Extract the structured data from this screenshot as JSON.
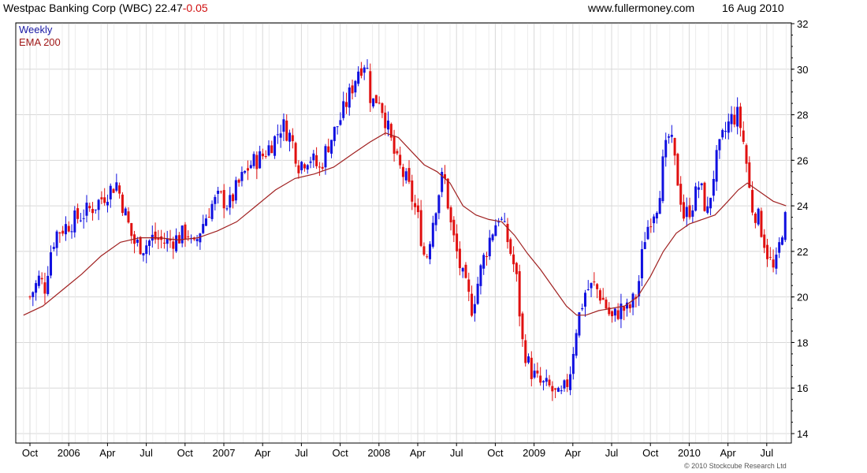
{
  "header": {
    "title": "Westpac Banking Corp (WBC)",
    "last": "22.47",
    "change": "-0.05",
    "site": "www.fullermoney.com",
    "date": "16 Aug 2010"
  },
  "legend": {
    "series1": "Weekly",
    "series2": "EMA 200"
  },
  "copyright": "© 2010 Stockcube Research Ltd",
  "colors": {
    "up": "#1010e0",
    "down": "#e01010",
    "ema": "#a02020",
    "grid": "#d8d8d8"
  },
  "chart_data": {
    "type": "candlestick",
    "ylim": [
      14,
      32
    ],
    "yticks": [
      14,
      16,
      18,
      20,
      22,
      24,
      26,
      28,
      30,
      32
    ],
    "x_range": [
      0,
      20.5
    ],
    "x_ticks": [
      {
        "label": "Oct",
        "m": 0.5
      },
      {
        "label": "2006",
        "m": 3.5
      },
      {
        "label": "Apr",
        "m": 6.5
      },
      {
        "label": "Jul",
        "m": 9.5
      },
      {
        "label": "Oct",
        "m": 12.5
      },
      {
        "label": "2007",
        "m": 15.5
      },
      {
        "label": "Apr",
        "m": 18.5
      },
      {
        "label": "Jul",
        "m": 21.5
      },
      {
        "label": "Oct",
        "m": 24.5
      },
      {
        "label": "2008",
        "m": 27.5
      },
      {
        "label": "Apr",
        "m": 30.5
      },
      {
        "label": "Jul",
        "m": 33.5
      },
      {
        "label": "Oct",
        "m": 36.5
      },
      {
        "label": "2009",
        "m": 39.5
      },
      {
        "label": "Apr",
        "m": 42.5
      },
      {
        "label": "Jul",
        "m": 45.5
      },
      {
        "label": "Oct",
        "m": 48.5
      },
      {
        "label": "2010",
        "m": 51.5
      },
      {
        "label": "Apr",
        "m": 54.5
      },
      {
        "label": "Jul",
        "m": 57.5
      }
    ],
    "x_axis_start_months_before_oct2005": 0,
    "price_path": [
      [
        0.0,
        20.0
      ],
      [
        0.7,
        20.8
      ],
      [
        1.2,
        20.4
      ],
      [
        1.5,
        21.8
      ],
      [
        2.0,
        22.8
      ],
      [
        3.0,
        23.2
      ],
      [
        4.0,
        23.6
      ],
      [
        5.0,
        24.0
      ],
      [
        6.0,
        24.6
      ],
      [
        6.7,
        25.0
      ],
      [
        7.3,
        23.8
      ],
      [
        8.0,
        22.4
      ],
      [
        8.8,
        22.2
      ],
      [
        9.5,
        22.6
      ],
      [
        10.5,
        22.4
      ],
      [
        11.5,
        22.6
      ],
      [
        12.2,
        22.9
      ],
      [
        12.6,
        22.0
      ],
      [
        13.2,
        23.0
      ],
      [
        14.0,
        24.0
      ],
      [
        14.7,
        24.4
      ],
      [
        15.4,
        24.0
      ],
      [
        16.0,
        24.8
      ],
      [
        17.0,
        25.8
      ],
      [
        18.0,
        26.2
      ],
      [
        19.0,
        27.0
      ],
      [
        19.5,
        27.6
      ],
      [
        20.2,
        27.0
      ],
      [
        20.8,
        25.8
      ],
      [
        21.6,
        26.2
      ],
      [
        22.4,
        25.6
      ],
      [
        23.0,
        26.6
      ],
      [
        24.0,
        27.8
      ],
      [
        24.8,
        29.0
      ],
      [
        25.4,
        30.0
      ],
      [
        26.0,
        30.4
      ],
      [
        26.4,
        28.5
      ],
      [
        27.0,
        28.8
      ],
      [
        27.6,
        27.6
      ],
      [
        28.3,
        26.0
      ],
      [
        29.2,
        25.0
      ],
      [
        30.0,
        23.5
      ],
      [
        30.6,
        21.5
      ],
      [
        31.3,
        23.8
      ],
      [
        32.0,
        25.5
      ],
      [
        32.6,
        23.0
      ],
      [
        33.4,
        21.0
      ],
      [
        34.2,
        19.5
      ],
      [
        35.0,
        21.5
      ],
      [
        35.7,
        22.8
      ],
      [
        36.3,
        23.6
      ],
      [
        36.9,
        22.6
      ],
      [
        37.6,
        21.0
      ],
      [
        38.1,
        18.0
      ],
      [
        38.7,
        16.8
      ],
      [
        39.4,
        16.2
      ],
      [
        40.2,
        16.0
      ],
      [
        41.0,
        15.5
      ],
      [
        41.7,
        16.4
      ],
      [
        42.3,
        18.8
      ],
      [
        43.0,
        20.3
      ],
      [
        43.7,
        20.5
      ],
      [
        44.4,
        19.8
      ],
      [
        45.0,
        19.0
      ],
      [
        45.7,
        19.5
      ],
      [
        46.3,
        19.4
      ],
      [
        47.0,
        20.2
      ],
      [
        47.5,
        22.5
      ],
      [
        48.0,
        23.5
      ],
      [
        48.6,
        24.2
      ],
      [
        49.0,
        26.0
      ],
      [
        49.5,
        27.2
      ],
      [
        50.0,
        25.5
      ],
      [
        50.6,
        23.5
      ],
      [
        51.2,
        24.0
      ],
      [
        51.8,
        25.0
      ],
      [
        52.4,
        23.6
      ],
      [
        53.0,
        25.8
      ],
      [
        53.6,
        27.0
      ],
      [
        54.2,
        27.8
      ],
      [
        54.8,
        28.0
      ],
      [
        55.3,
        26.5
      ],
      [
        55.8,
        24.0
      ],
      [
        56.4,
        23.4
      ],
      [
        57.0,
        22.0
      ],
      [
        57.6,
        21.0
      ],
      [
        58.2,
        23.0
      ],
      [
        58.8,
        24.0
      ],
      [
        59.4,
        22.4
      ]
    ],
    "ema_path": [
      [
        -0.5,
        19.2
      ],
      [
        1.0,
        19.6
      ],
      [
        2.5,
        20.3
      ],
      [
        4.0,
        21.0
      ],
      [
        5.5,
        21.8
      ],
      [
        7.0,
        22.4
      ],
      [
        8.5,
        22.6
      ],
      [
        10.0,
        22.6
      ],
      [
        11.5,
        22.5
      ],
      [
        13.0,
        22.6
      ],
      [
        14.5,
        22.9
      ],
      [
        16.0,
        23.3
      ],
      [
        17.5,
        24.0
      ],
      [
        19.0,
        24.7
      ],
      [
        20.5,
        25.2
      ],
      [
        22.0,
        25.4
      ],
      [
        23.5,
        25.7
      ],
      [
        25.0,
        26.3
      ],
      [
        26.3,
        26.8
      ],
      [
        27.5,
        27.2
      ],
      [
        28.5,
        27.0
      ],
      [
        29.5,
        26.4
      ],
      [
        30.5,
        25.8
      ],
      [
        31.5,
        25.5
      ],
      [
        32.5,
        25.0
      ],
      [
        33.5,
        24.0
      ],
      [
        34.5,
        23.6
      ],
      [
        35.5,
        23.4
      ],
      [
        36.5,
        23.3
      ],
      [
        37.5,
        22.7
      ],
      [
        38.5,
        21.9
      ],
      [
        39.5,
        21.2
      ],
      [
        40.5,
        20.4
      ],
      [
        41.5,
        19.6
      ],
      [
        42.3,
        19.2
      ],
      [
        43.0,
        19.2
      ],
      [
        44.0,
        19.4
      ],
      [
        45.0,
        19.5
      ],
      [
        46.0,
        19.6
      ],
      [
        47.0,
        20.0
      ],
      [
        48.0,
        20.9
      ],
      [
        49.0,
        22.0
      ],
      [
        50.0,
        22.8
      ],
      [
        51.0,
        23.2
      ],
      [
        52.0,
        23.4
      ],
      [
        53.0,
        23.6
      ],
      [
        54.0,
        24.2
      ],
      [
        54.8,
        24.7
      ],
      [
        55.5,
        25.0
      ],
      [
        56.5,
        24.6
      ],
      [
        57.5,
        24.2
      ],
      [
        58.5,
        24.0
      ],
      [
        59.3,
        23.9
      ]
    ]
  }
}
